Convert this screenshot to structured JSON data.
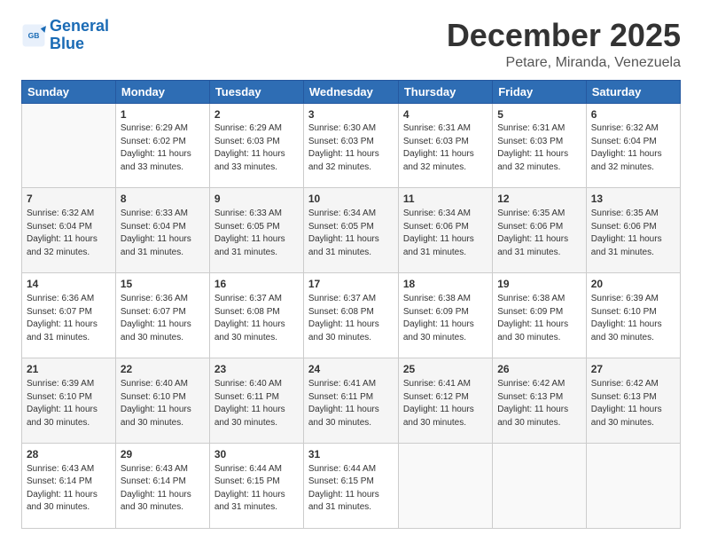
{
  "logo": {
    "line1": "General",
    "line2": "Blue"
  },
  "header": {
    "month": "December 2025",
    "location": "Petare, Miranda, Venezuela"
  },
  "days_of_week": [
    "Sunday",
    "Monday",
    "Tuesday",
    "Wednesday",
    "Thursday",
    "Friday",
    "Saturday"
  ],
  "weeks": [
    [
      {
        "day": "",
        "info": ""
      },
      {
        "day": "1",
        "info": "Sunrise: 6:29 AM\nSunset: 6:02 PM\nDaylight: 11 hours\nand 33 minutes."
      },
      {
        "day": "2",
        "info": "Sunrise: 6:29 AM\nSunset: 6:03 PM\nDaylight: 11 hours\nand 33 minutes."
      },
      {
        "day": "3",
        "info": "Sunrise: 6:30 AM\nSunset: 6:03 PM\nDaylight: 11 hours\nand 32 minutes."
      },
      {
        "day": "4",
        "info": "Sunrise: 6:31 AM\nSunset: 6:03 PM\nDaylight: 11 hours\nand 32 minutes."
      },
      {
        "day": "5",
        "info": "Sunrise: 6:31 AM\nSunset: 6:03 PM\nDaylight: 11 hours\nand 32 minutes."
      },
      {
        "day": "6",
        "info": "Sunrise: 6:32 AM\nSunset: 6:04 PM\nDaylight: 11 hours\nand 32 minutes."
      }
    ],
    [
      {
        "day": "7",
        "info": "Sunrise: 6:32 AM\nSunset: 6:04 PM\nDaylight: 11 hours\nand 32 minutes."
      },
      {
        "day": "8",
        "info": "Sunrise: 6:33 AM\nSunset: 6:04 PM\nDaylight: 11 hours\nand 31 minutes."
      },
      {
        "day": "9",
        "info": "Sunrise: 6:33 AM\nSunset: 6:05 PM\nDaylight: 11 hours\nand 31 minutes."
      },
      {
        "day": "10",
        "info": "Sunrise: 6:34 AM\nSunset: 6:05 PM\nDaylight: 11 hours\nand 31 minutes."
      },
      {
        "day": "11",
        "info": "Sunrise: 6:34 AM\nSunset: 6:06 PM\nDaylight: 11 hours\nand 31 minutes."
      },
      {
        "day": "12",
        "info": "Sunrise: 6:35 AM\nSunset: 6:06 PM\nDaylight: 11 hours\nand 31 minutes."
      },
      {
        "day": "13",
        "info": "Sunrise: 6:35 AM\nSunset: 6:06 PM\nDaylight: 11 hours\nand 31 minutes."
      }
    ],
    [
      {
        "day": "14",
        "info": "Sunrise: 6:36 AM\nSunset: 6:07 PM\nDaylight: 11 hours\nand 31 minutes."
      },
      {
        "day": "15",
        "info": "Sunrise: 6:36 AM\nSunset: 6:07 PM\nDaylight: 11 hours\nand 30 minutes."
      },
      {
        "day": "16",
        "info": "Sunrise: 6:37 AM\nSunset: 6:08 PM\nDaylight: 11 hours\nand 30 minutes."
      },
      {
        "day": "17",
        "info": "Sunrise: 6:37 AM\nSunset: 6:08 PM\nDaylight: 11 hours\nand 30 minutes."
      },
      {
        "day": "18",
        "info": "Sunrise: 6:38 AM\nSunset: 6:09 PM\nDaylight: 11 hours\nand 30 minutes."
      },
      {
        "day": "19",
        "info": "Sunrise: 6:38 AM\nSunset: 6:09 PM\nDaylight: 11 hours\nand 30 minutes."
      },
      {
        "day": "20",
        "info": "Sunrise: 6:39 AM\nSunset: 6:10 PM\nDaylight: 11 hours\nand 30 minutes."
      }
    ],
    [
      {
        "day": "21",
        "info": "Sunrise: 6:39 AM\nSunset: 6:10 PM\nDaylight: 11 hours\nand 30 minutes."
      },
      {
        "day": "22",
        "info": "Sunrise: 6:40 AM\nSunset: 6:10 PM\nDaylight: 11 hours\nand 30 minutes."
      },
      {
        "day": "23",
        "info": "Sunrise: 6:40 AM\nSunset: 6:11 PM\nDaylight: 11 hours\nand 30 minutes."
      },
      {
        "day": "24",
        "info": "Sunrise: 6:41 AM\nSunset: 6:11 PM\nDaylight: 11 hours\nand 30 minutes."
      },
      {
        "day": "25",
        "info": "Sunrise: 6:41 AM\nSunset: 6:12 PM\nDaylight: 11 hours\nand 30 minutes."
      },
      {
        "day": "26",
        "info": "Sunrise: 6:42 AM\nSunset: 6:13 PM\nDaylight: 11 hours\nand 30 minutes."
      },
      {
        "day": "27",
        "info": "Sunrise: 6:42 AM\nSunset: 6:13 PM\nDaylight: 11 hours\nand 30 minutes."
      }
    ],
    [
      {
        "day": "28",
        "info": "Sunrise: 6:43 AM\nSunset: 6:14 PM\nDaylight: 11 hours\nand 30 minutes."
      },
      {
        "day": "29",
        "info": "Sunrise: 6:43 AM\nSunset: 6:14 PM\nDaylight: 11 hours\nand 30 minutes."
      },
      {
        "day": "30",
        "info": "Sunrise: 6:44 AM\nSunset: 6:15 PM\nDaylight: 11 hours\nand 31 minutes."
      },
      {
        "day": "31",
        "info": "Sunrise: 6:44 AM\nSunset: 6:15 PM\nDaylight: 11 hours\nand 31 minutes."
      },
      {
        "day": "",
        "info": ""
      },
      {
        "day": "",
        "info": ""
      },
      {
        "day": "",
        "info": ""
      }
    ]
  ]
}
